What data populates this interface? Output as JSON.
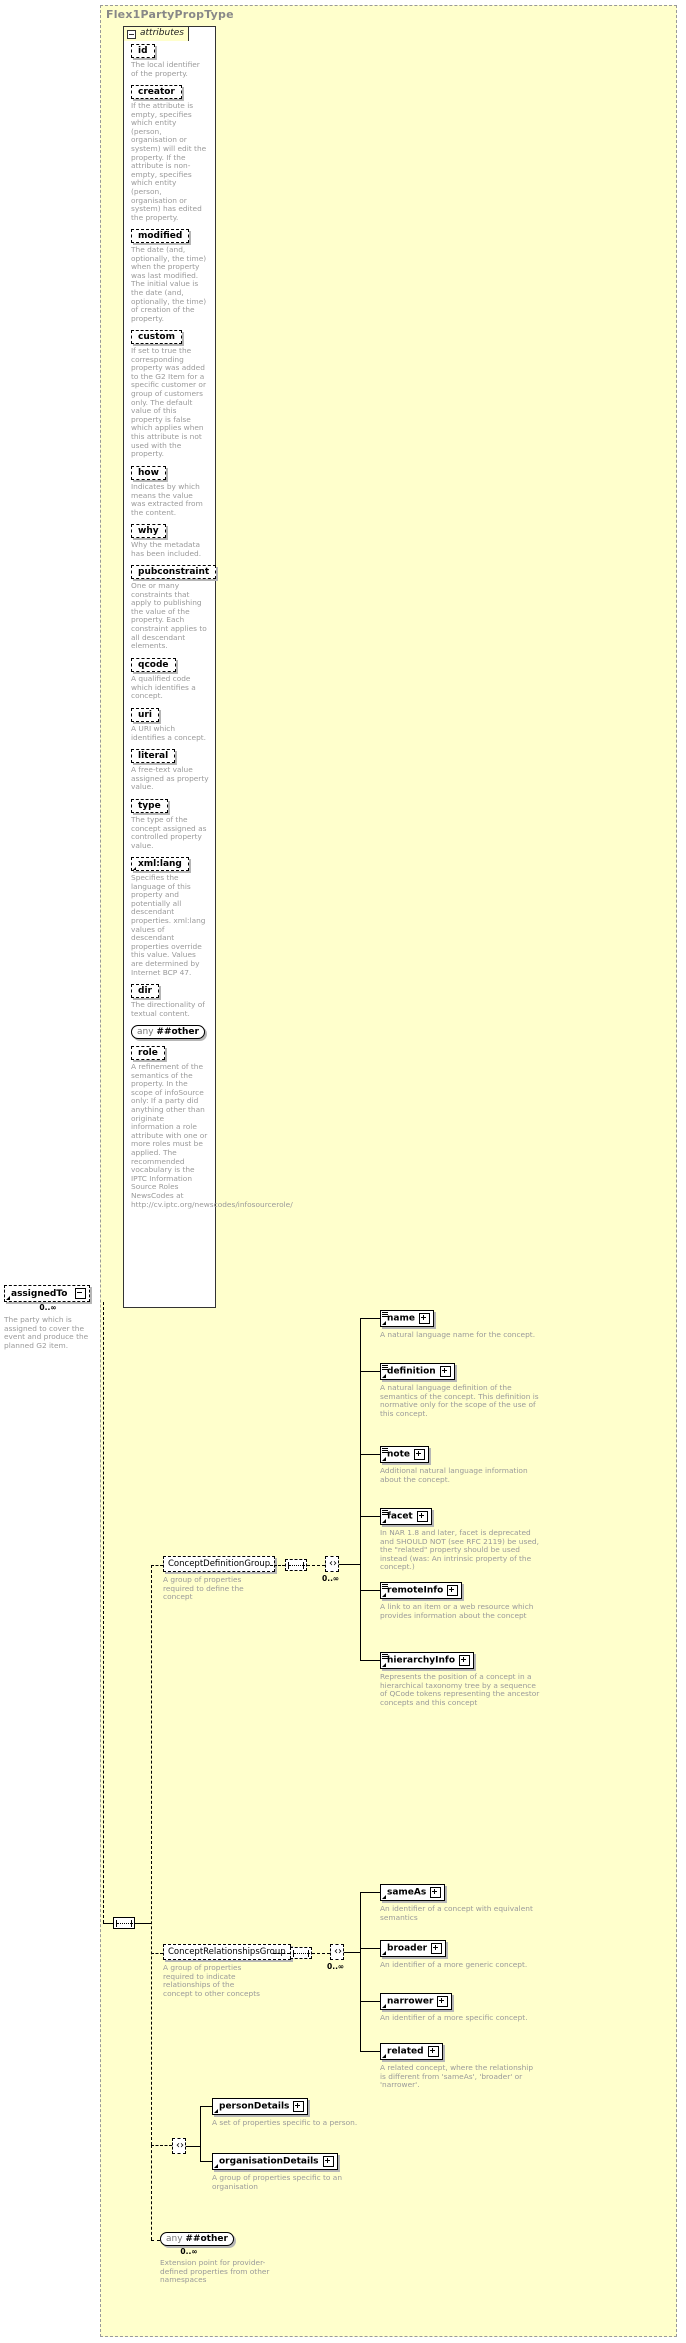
{
  "diagram": {
    "type_name": "Flex1PartyPropType",
    "attributes_tab_label": "attributes"
  },
  "attributes": [
    {
      "name": "id",
      "desc": "The local identifier of the property."
    },
    {
      "name": "creator",
      "desc": "If the attribute is empty, specifies which entity (person, organisation or system) will edit the property. If the attribute is non-empty, specifies which entity (person, organisation or system) has edited the property."
    },
    {
      "name": "modified",
      "desc": "The date (and, optionally, the time) when the property was last modified. The initial value is the date (and, optionally, the time) of creation of the property."
    },
    {
      "name": "custom",
      "desc": "If set to true the corresponding property was added to the G2 Item for a specific customer or group of customers only. The default value of this property is false which applies when this attribute is not used with the property."
    },
    {
      "name": "how",
      "desc": "Indicates by which means the value was extracted from the content."
    },
    {
      "name": "why",
      "desc": "Why the metadata has been included."
    },
    {
      "name": "pubconstraint",
      "desc": "One or many constraints that apply to publishing the value of the property. Each constraint applies to all descendant elements."
    },
    {
      "name": "qcode",
      "desc": "A qualified code which identifies a concept."
    },
    {
      "name": "uri",
      "desc": "A URI which identifies a concept."
    },
    {
      "name": "literal",
      "desc": "A free-text value assigned as property value."
    },
    {
      "name": "type",
      "desc": "The type of the concept assigned as controlled property value."
    },
    {
      "name": "xml:lang",
      "desc": "Specifies the language of this property and potentially all descendant properties. xml:lang values of descendant properties override this value. Values are determined by Internet BCP 47."
    },
    {
      "name": "dir",
      "desc": "The directionality of textual content."
    },
    {
      "name": "any ##other",
      "is_any": true,
      "any_prefix": "any",
      "any_label": "##other",
      "desc": ""
    },
    {
      "name": "role",
      "desc": "A refinement of the semantics of the property. In the scope of infoSource only: If a party did anything other than originate information a role attribute with one or more roles must be applied. The recommended vocabulary is the IPTC Information Source Roles NewsCodes at http://cv.iptc.org/newscodes/infosourcerole/"
    }
  ],
  "root_element": {
    "name": "assignedTo",
    "occurs": "0..∞",
    "desc": "The party which is assigned to cover the event and produce the planned G2 item."
  },
  "groups": [
    {
      "name": "ConceptDefinitionGroup",
      "desc": "A group of properties required to define the concept",
      "occurs": "0..∞",
      "children": [
        {
          "name": "name",
          "ctl": "plus",
          "desc": "A natural language name for the concept."
        },
        {
          "name": "definition",
          "ctl": "plus",
          "desc": "A natural language definition of the semantics of the concept. This definition is normative only for the scope of the use of this concept."
        },
        {
          "name": "note",
          "ctl": "plus",
          "desc": "Additional natural language information about the concept."
        },
        {
          "name": "facet",
          "ctl": "plus",
          "desc": "In NAR 1.8 and later, facet is deprecated and SHOULD NOT (see RFC 2119) be used, the \"related\" property should be used instead (was: An intrinsic property of the concept.)"
        },
        {
          "name": "remoteInfo",
          "ctl": "plus",
          "desc": "A link to an item or a web resource which provides information about the concept"
        },
        {
          "name": "hierarchyInfo",
          "ctl": "plus",
          "desc": "Represents the position of a concept in a hierarchical taxonomy tree by a sequence of QCode tokens representing the ancestor concepts and this concept"
        }
      ]
    },
    {
      "name": "ConceptRelationshipsGroup",
      "desc": "A group of properties required to indicate relationships of the concept to other concepts",
      "occurs": "0..∞",
      "children": [
        {
          "name": "sameAs",
          "ctl": "plus",
          "desc": "An identifier of a concept with equivalent semantics"
        },
        {
          "name": "broader",
          "ctl": "plus",
          "desc": "An identifier of a more generic concept."
        },
        {
          "name": "narrower",
          "ctl": "plus",
          "desc": "An identifier of a more specific concept."
        },
        {
          "name": "related",
          "ctl": "plus",
          "desc": "A related concept, where the relationship is different from 'sameAs', 'broader' or 'narrower'."
        }
      ]
    }
  ],
  "detail_elements": [
    {
      "name": "personDetails",
      "ctl": "plus",
      "desc": "A set of properties specific to a person."
    },
    {
      "name": "organisationDetails",
      "ctl": "plus",
      "desc": "A group of properties specific to an organisation"
    }
  ],
  "extension": {
    "prefix": "any",
    "label": "##other",
    "occurs": "0..∞",
    "desc": "Extension point for provider-defined properties from other namespaces"
  }
}
